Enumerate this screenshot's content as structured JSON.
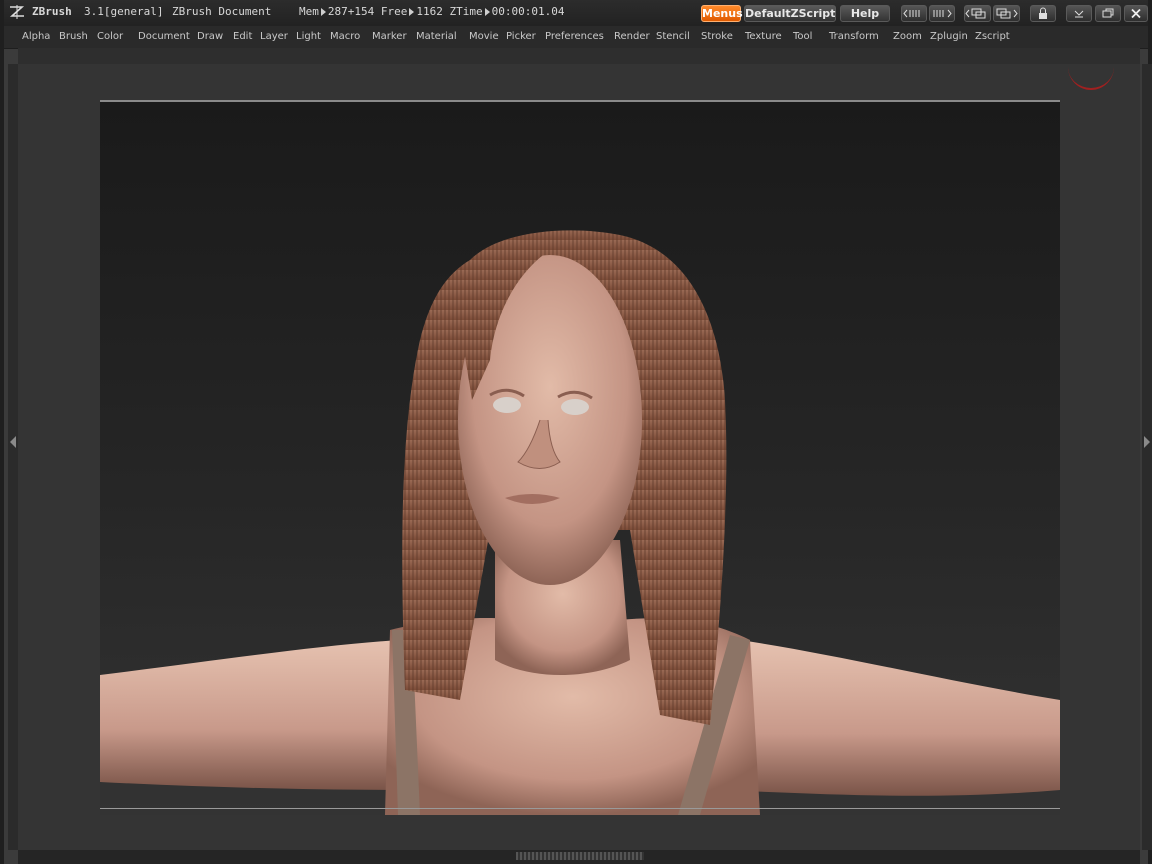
{
  "titlebar": {
    "app_name": "ZBrush",
    "version": "3.1[general]",
    "document_name": "ZBrush Document",
    "mem_label": "Mem",
    "mem_value": "287+154",
    "free_label": "Free",
    "free_value": "1162",
    "ztime_label": "ZTime",
    "ztime_value": "00:00:01.04",
    "buttons": {
      "menus": "Menus",
      "default_zscript": "DefaultZScript",
      "help": "Help"
    }
  },
  "menubar": {
    "items": [
      "Alpha",
      "Brush",
      "Color",
      "Document",
      "Draw",
      "Edit",
      "Layer",
      "Light",
      "Macro",
      "Marker",
      "Material",
      "Movie",
      "Picker",
      "Preferences",
      "Render",
      "Stencil",
      "Stroke",
      "Texture",
      "Tool",
      "Transform",
      "Zoom",
      "Zplugin",
      "Zscript"
    ]
  },
  "colors": {
    "accent": "#f07010",
    "background": "#3b3b3b",
    "canvas": "#1e1e1e",
    "skin": "#c89a88",
    "hair": "#8a5a46"
  },
  "icons": [
    "zbrush-logo-icon",
    "scroll-left-icon",
    "scroll-right-icon",
    "layout-left-icon",
    "layout-right-icon",
    "lock-icon",
    "minimize-icon",
    "restore-icon",
    "close-icon"
  ]
}
